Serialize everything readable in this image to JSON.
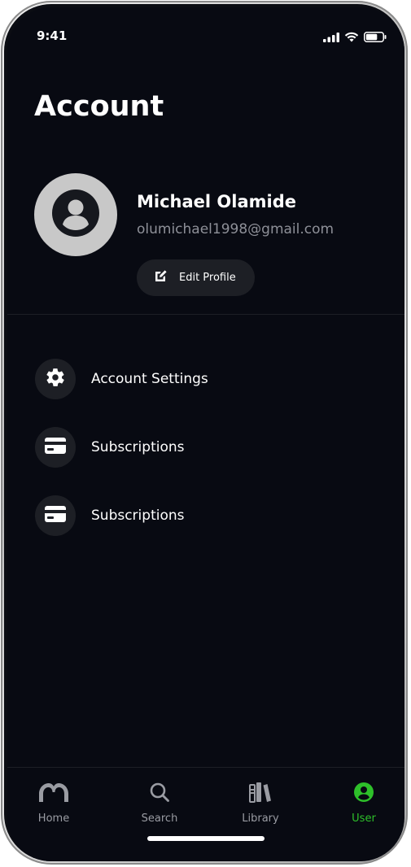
{
  "status_bar": {
    "time": "9:41"
  },
  "page": {
    "title": "Account"
  },
  "profile": {
    "name": "Michael Olamide",
    "email": "olumichael1998@gmail.com",
    "edit_label": "Edit Profile"
  },
  "menu": {
    "items": [
      {
        "label": "Account Settings",
        "icon": "gear-icon"
      },
      {
        "label": "Subscriptions",
        "icon": "credit-card-icon"
      },
      {
        "label": "Subscriptions",
        "icon": "credit-card-icon"
      }
    ]
  },
  "tab_bar": {
    "tabs": [
      {
        "label": "Home",
        "icon": "home-logo-icon",
        "active": false
      },
      {
        "label": "Search",
        "icon": "search-icon",
        "active": false
      },
      {
        "label": "Library",
        "icon": "library-icon",
        "active": false
      },
      {
        "label": "User",
        "icon": "user-icon",
        "active": true
      }
    ]
  },
  "colors": {
    "background": "#080a12",
    "surface": "#1d1f25",
    "accent": "#2ec02a",
    "muted_text": "#8e9098"
  }
}
